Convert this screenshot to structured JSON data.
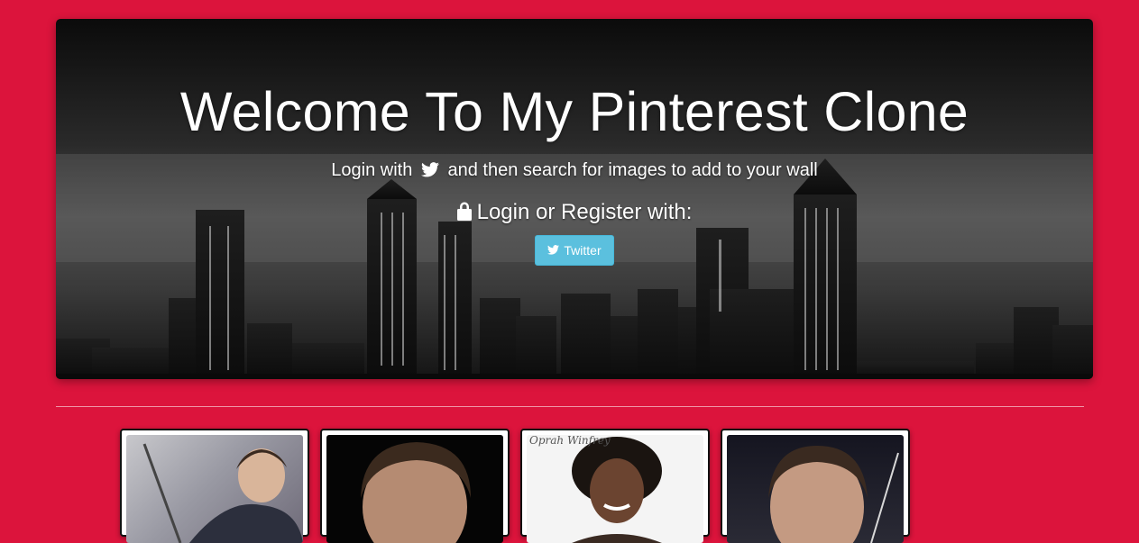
{
  "hero": {
    "title": "Welcome To My Pinterest Clone",
    "subtitle_before": "Login with",
    "subtitle_after": "and then search for images to add to your wall",
    "login_text": "Login or Register with:",
    "twitter_button_label": "Twitter"
  },
  "cards": [
    {
      "icon": "person-photo",
      "caption": ""
    },
    {
      "icon": "person-photo",
      "caption": ""
    },
    {
      "icon": "person-photo",
      "caption": "Oprah Winfrey"
    },
    {
      "icon": "person-photo",
      "caption": ""
    }
  ],
  "colors": {
    "page_background": "#dc143c",
    "twitter_button": "#5bc0de"
  }
}
